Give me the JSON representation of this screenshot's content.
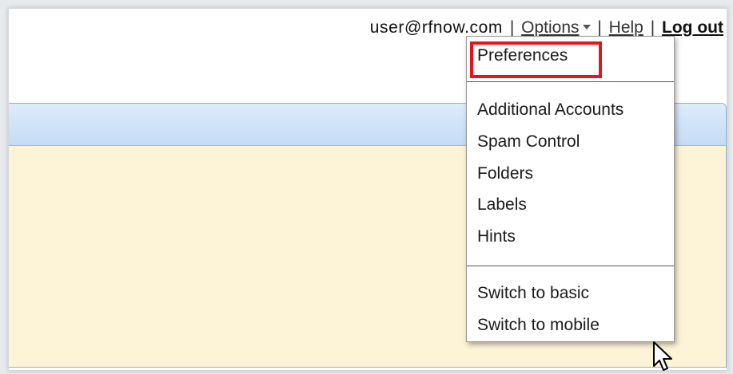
{
  "header": {
    "user_email": "user@rfnow.com",
    "options_label": "Options",
    "help_label": "Help",
    "logout_label": "Log out",
    "separator": "|"
  },
  "dropdown": {
    "group1": [
      {
        "label": "Preferences"
      }
    ],
    "group2": [
      {
        "label": "Additional Accounts"
      },
      {
        "label": "Spam Control"
      },
      {
        "label": "Folders"
      },
      {
        "label": "Labels"
      },
      {
        "label": "Hints"
      }
    ],
    "group3": [
      {
        "label": "Switch to basic"
      },
      {
        "label": "Switch to mobile"
      }
    ]
  },
  "colors": {
    "highlight": "#e3161b",
    "panel_header": "#c3dcf5",
    "panel_body": "#fdf3d6"
  },
  "icons": {
    "options_caret": "chevron-down-icon",
    "mouse_pointer": "cursor-arrow-icon"
  }
}
